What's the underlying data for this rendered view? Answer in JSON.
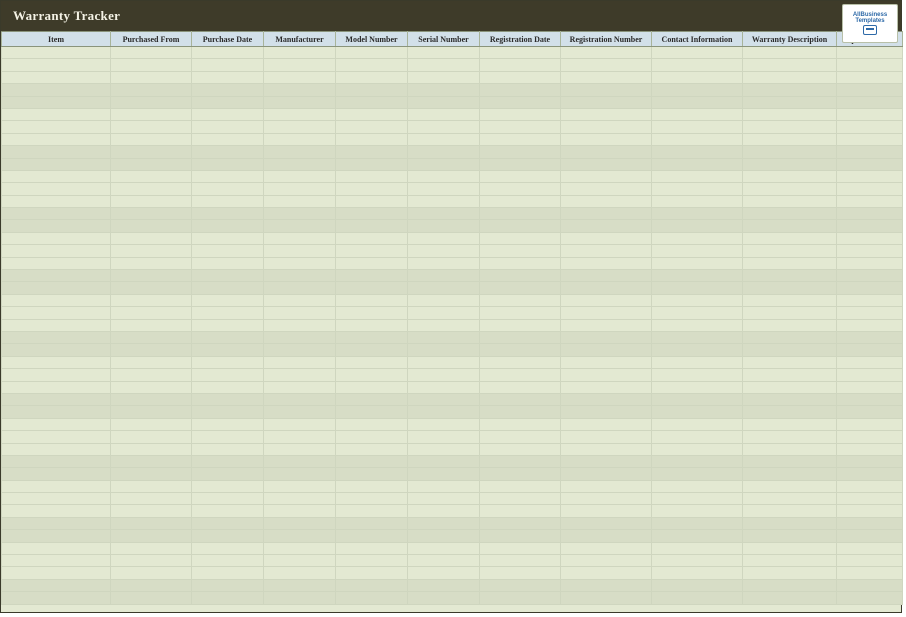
{
  "header": {
    "title": "Warranty Tracker"
  },
  "logo": {
    "line1": "AllBusiness",
    "line2": "Templates"
  },
  "columns": [
    "Item",
    "Purchased From",
    "Purchase Date",
    "Manufacturer",
    "Model Number",
    "Serial Number",
    "Registration Date",
    "Registration Number",
    "Contact Information",
    "Warranty Description",
    "Expiration Date"
  ],
  "rows": [
    [
      "",
      "",
      "",
      "",
      "",
      "",
      "",
      "",
      "",
      "",
      ""
    ],
    [
      "",
      "",
      "",
      "",
      "",
      "",
      "",
      "",
      "",
      "",
      ""
    ],
    [
      "",
      "",
      "",
      "",
      "",
      "",
      "",
      "",
      "",
      "",
      ""
    ],
    [
      "",
      "",
      "",
      "",
      "",
      "",
      "",
      "",
      "",
      "",
      ""
    ],
    [
      "",
      "",
      "",
      "",
      "",
      "",
      "",
      "",
      "",
      "",
      ""
    ],
    [
      "",
      "",
      "",
      "",
      "",
      "",
      "",
      "",
      "",
      "",
      ""
    ],
    [
      "",
      "",
      "",
      "",
      "",
      "",
      "",
      "",
      "",
      "",
      ""
    ],
    [
      "",
      "",
      "",
      "",
      "",
      "",
      "",
      "",
      "",
      "",
      ""
    ],
    [
      "",
      "",
      "",
      "",
      "",
      "",
      "",
      "",
      "",
      "",
      ""
    ],
    [
      "",
      "",
      "",
      "",
      "",
      "",
      "",
      "",
      "",
      "",
      ""
    ],
    [
      "",
      "",
      "",
      "",
      "",
      "",
      "",
      "",
      "",
      "",
      ""
    ],
    [
      "",
      "",
      "",
      "",
      "",
      "",
      "",
      "",
      "",
      "",
      ""
    ],
    [
      "",
      "",
      "",
      "",
      "",
      "",
      "",
      "",
      "",
      "",
      ""
    ],
    [
      "",
      "",
      "",
      "",
      "",
      "",
      "",
      "",
      "",
      "",
      ""
    ],
    [
      "",
      "",
      "",
      "",
      "",
      "",
      "",
      "",
      "",
      "",
      ""
    ],
    [
      "",
      "",
      "",
      "",
      "",
      "",
      "",
      "",
      "",
      "",
      ""
    ],
    [
      "",
      "",
      "",
      "",
      "",
      "",
      "",
      "",
      "",
      "",
      ""
    ],
    [
      "",
      "",
      "",
      "",
      "",
      "",
      "",
      "",
      "",
      "",
      ""
    ],
    [
      "",
      "",
      "",
      "",
      "",
      "",
      "",
      "",
      "",
      "",
      ""
    ],
    [
      "",
      "",
      "",
      "",
      "",
      "",
      "",
      "",
      "",
      "",
      ""
    ],
    [
      "",
      "",
      "",
      "",
      "",
      "",
      "",
      "",
      "",
      "",
      ""
    ],
    [
      "",
      "",
      "",
      "",
      "",
      "",
      "",
      "",
      "",
      "",
      ""
    ],
    [
      "",
      "",
      "",
      "",
      "",
      "",
      "",
      "",
      "",
      "",
      ""
    ],
    [
      "",
      "",
      "",
      "",
      "",
      "",
      "",
      "",
      "",
      "",
      ""
    ],
    [
      "",
      "",
      "",
      "",
      "",
      "",
      "",
      "",
      "",
      "",
      ""
    ],
    [
      "",
      "",
      "",
      "",
      "",
      "",
      "",
      "",
      "",
      "",
      ""
    ],
    [
      "",
      "",
      "",
      "",
      "",
      "",
      "",
      "",
      "",
      "",
      ""
    ],
    [
      "",
      "",
      "",
      "",
      "",
      "",
      "",
      "",
      "",
      "",
      ""
    ],
    [
      "",
      "",
      "",
      "",
      "",
      "",
      "",
      "",
      "",
      "",
      ""
    ],
    [
      "",
      "",
      "",
      "",
      "",
      "",
      "",
      "",
      "",
      "",
      ""
    ],
    [
      "",
      "",
      "",
      "",
      "",
      "",
      "",
      "",
      "",
      "",
      ""
    ],
    [
      "",
      "",
      "",
      "",
      "",
      "",
      "",
      "",
      "",
      "",
      ""
    ],
    [
      "",
      "",
      "",
      "",
      "",
      "",
      "",
      "",
      "",
      "",
      ""
    ],
    [
      "",
      "",
      "",
      "",
      "",
      "",
      "",
      "",
      "",
      "",
      ""
    ],
    [
      "",
      "",
      "",
      "",
      "",
      "",
      "",
      "",
      "",
      "",
      ""
    ],
    [
      "",
      "",
      "",
      "",
      "",
      "",
      "",
      "",
      "",
      "",
      ""
    ],
    [
      "",
      "",
      "",
      "",
      "",
      "",
      "",
      "",
      "",
      "",
      ""
    ],
    [
      "",
      "",
      "",
      "",
      "",
      "",
      "",
      "",
      "",
      "",
      ""
    ],
    [
      "",
      "",
      "",
      "",
      "",
      "",
      "",
      "",
      "",
      "",
      ""
    ],
    [
      "",
      "",
      "",
      "",
      "",
      "",
      "",
      "",
      "",
      "",
      ""
    ],
    [
      "",
      "",
      "",
      "",
      "",
      "",
      "",
      "",
      "",
      "",
      ""
    ],
    [
      "",
      "",
      "",
      "",
      "",
      "",
      "",
      "",
      "",
      "",
      ""
    ],
    [
      "",
      "",
      "",
      "",
      "",
      "",
      "",
      "",
      "",
      "",
      ""
    ],
    [
      "",
      "",
      "",
      "",
      "",
      "",
      "",
      "",
      "",
      "",
      ""
    ],
    [
      "",
      "",
      "",
      "",
      "",
      "",
      "",
      "",
      "",
      "",
      ""
    ]
  ],
  "banding": [
    3,
    4,
    8,
    9,
    13,
    14,
    18,
    19,
    23,
    24,
    28,
    29,
    33,
    34,
    38,
    39,
    43,
    44
  ]
}
